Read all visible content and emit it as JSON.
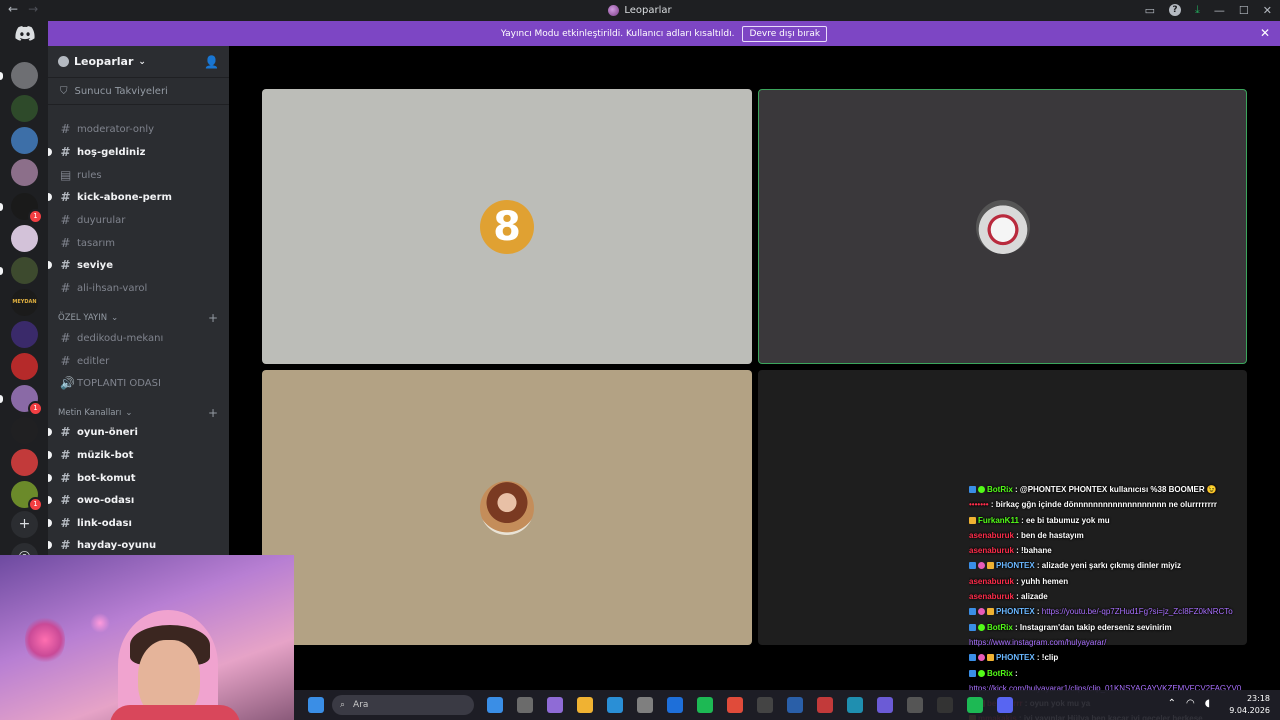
{
  "titlebar": {
    "back": "←",
    "forward": "→",
    "title": "Leoparlar",
    "window_controls": [
      "—",
      "☐",
      "✕"
    ]
  },
  "banner": {
    "text": "Yayıncı Modu etkinleştirildi. Kullanıcı adları kısaltıldı.",
    "button": "Devre dışı bırak",
    "close": "✕"
  },
  "rail": {
    "home_icon": "discord-logo-icon",
    "servers": [
      {
        "color": "#6e6f73",
        "badge": ""
      },
      {
        "color": "#2e4a2a",
        "badge": ""
      },
      {
        "color": "#3d6fa8",
        "badge": ""
      },
      {
        "color": "#8c6f8a",
        "badge": ""
      },
      {
        "color": "#1a1a1a",
        "badge": "1"
      },
      {
        "color": "#d3c2d9",
        "badge": ""
      },
      {
        "color": "#3d4a2e",
        "badge": ""
      },
      {
        "color": "#1b1b1b",
        "badge": ""
      },
      {
        "color": "#3a2a6a",
        "badge": ""
      },
      {
        "color": "#b52a2a",
        "badge": ""
      },
      {
        "color": "#8a6aa6",
        "badge": "1"
      },
      {
        "color": "#202022",
        "badge": ""
      },
      {
        "color": "#c23a3a",
        "badge": ""
      },
      {
        "color": "#6b8a2a",
        "badge": "1"
      }
    ],
    "meydan_label": "MEYDAN",
    "add_server": "+"
  },
  "sidebar": {
    "guild_name": "Leoparlar",
    "boost_label": "Sunucu Takviyeleri",
    "channels_top": [
      {
        "name": "moderator-only",
        "unread": false
      },
      {
        "name": "hoş-geldiniz",
        "unread": true
      },
      {
        "name": "rules",
        "unread": false
      },
      {
        "name": "kick-abone-perm",
        "unread": true
      },
      {
        "name": "duyurular",
        "unread": false
      },
      {
        "name": "tasarım",
        "unread": false
      },
      {
        "name": "seviye",
        "unread": true
      },
      {
        "name": "ali-ihsan-varol",
        "unread": false
      }
    ],
    "category_ozel": "ÖZEL YAYIN",
    "channels_ozel": [
      {
        "name": "dedikodu-mekanı",
        "unread": false
      },
      {
        "name": "editler",
        "unread": false
      },
      {
        "name": "TOPLANTI ODASI",
        "unread": false
      }
    ],
    "category_metin": "Metin Kanalları",
    "channels_metin": [
      {
        "name": "oyun-öneri",
        "unread": true
      },
      {
        "name": "müzik-bot",
        "unread": true
      },
      {
        "name": "bot-komut",
        "unread": true
      },
      {
        "name": "owo-odası",
        "unread": true
      },
      {
        "name": "link-odası",
        "unread": true
      },
      {
        "name": "hayday-oyunu",
        "unread": true
      }
    ]
  },
  "video": {
    "tile1_avatar_text": "8"
  },
  "chat": [
    {
      "user": "BotRix",
      "ucls": "u-bot",
      "icons": [
        "blue",
        "green"
      ],
      "text": "@PHONTEX PHONTEX kullanıcısı %38 BOOMER 😉"
    },
    {
      "user": "•••••••",
      "ucls": "u-red",
      "icons": [],
      "text": "birkaç gğn içinde dönnnnnnnnnnnnnnnnnnn ne olurrrrrrrr"
    },
    {
      "user": "FurkanK11",
      "ucls": "u-furkan",
      "icons": [
        "yellow"
      ],
      "text": "ee bi tabumuz yok mu"
    },
    {
      "user": "asenaburuk",
      "ucls": "u-red",
      "icons": [],
      "text": "ben de hastayım"
    },
    {
      "user": "asenaburuk",
      "ucls": "u-red",
      "icons": [],
      "text": "!bahane"
    },
    {
      "user": "PHONTEX",
      "ucls": "u-phontex",
      "icons": [
        "blue",
        "badge-pink",
        "yellow"
      ],
      "text": "alizade yeni şarkı çıkmış dinler miyiz"
    },
    {
      "user": "asenaburuk",
      "ucls": "u-red",
      "icons": [],
      "text": "yuhh hemen"
    },
    {
      "user": "asenaburuk",
      "ucls": "u-red",
      "icons": [],
      "text": "alizade"
    },
    {
      "user": "PHONTEX",
      "ucls": "u-phontex",
      "icons": [
        "blue",
        "badge-pink",
        "yellow"
      ],
      "text": "https://youtu.be/-qp7ZHud1Fg?si=jz_ZcI8FZ0kNRCTo",
      "link": true
    },
    {
      "user": "BotRix",
      "ucls": "u-bot",
      "icons": [
        "blue",
        "green"
      ],
      "text": "Instagram'dan takip ederseniz sevinirim"
    },
    {
      "user": "",
      "ucls": "",
      "icons": [],
      "text": "https://www.instagram.com/hulyayarar/",
      "link": true,
      "cont": true
    },
    {
      "user": "PHONTEX",
      "ucls": "u-phontex",
      "icons": [
        "blue",
        "badge-pink",
        "yellow"
      ],
      "text": "!clip"
    },
    {
      "user": "BotRix",
      "ucls": "u-bot",
      "icons": [
        "blue",
        "green"
      ],
      "text": ""
    },
    {
      "user": "",
      "ucls": "",
      "icons": [],
      "text": "https://kick.com/hulyayarar1/clips/clip_01KNSYAGAYVKZEMVFCV2FAGYV0",
      "link": true,
      "cont": true
    },
    {
      "user": "bergtrrrrr",
      "ucls": "u-red",
      "icons": [
        "blue",
        "yellow"
      ],
      "text": "oyun yok mu ya"
    },
    {
      "user": "mmakakis",
      "ucls": "u-red",
      "icons": [
        "yellow"
      ],
      "text": "iyi yayınlar Hülya ben kaçar iyi geceler herkese"
    }
  ],
  "taskbar": {
    "search_placeholder": "Ara",
    "time": "23:18",
    "date": "9.04.2026",
    "apps": [
      "#3a8ee6",
      "#6b6b6b",
      "#8f6bd6",
      "#f0b232",
      "#2a8fd6",
      "#7f7f7f",
      "#1e6fd9",
      "#1db954",
      "#e04b3a",
      "#444",
      "#2a5fa8",
      "#c23a3a",
      "#1f8fb0",
      "#6b5bd6",
      "#555",
      "#333",
      "#1db954",
      "#5865f2"
    ]
  }
}
